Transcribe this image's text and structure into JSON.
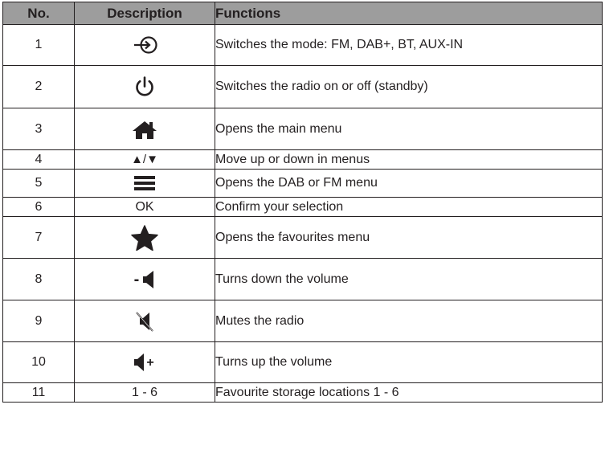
{
  "headers": {
    "no": "No.",
    "description": "Description",
    "functions": "Functions"
  },
  "rows": [
    {
      "no": "1",
      "icon": "mode-icon",
      "function": "Switches the mode: FM, DAB+, BT, AUX-IN"
    },
    {
      "no": "2",
      "icon": "power-icon",
      "function": "Switches the radio on or off (standby)"
    },
    {
      "no": "3",
      "icon": "home-icon",
      "function": "Opens the main menu"
    },
    {
      "no": "4",
      "description": "▲/▼",
      "function": "Move up or down in menus"
    },
    {
      "no": "5",
      "icon": "menu-icon",
      "function": "Opens the DAB or FM menu"
    },
    {
      "no": "6",
      "description": "OK",
      "function": "Confirm your selection"
    },
    {
      "no": "7",
      "icon": "star-icon",
      "function": "Opens the favourites menu"
    },
    {
      "no": "8",
      "icon": "volume-down-icon",
      "description": "-",
      "function": "Turns down the volume"
    },
    {
      "no": "9",
      "icon": "mute-icon",
      "function": "Mutes the radio"
    },
    {
      "no": "10",
      "icon": "volume-up-icon",
      "description": "+",
      "function": "Turns up the volume"
    },
    {
      "no": "11",
      "description": "1 - 6",
      "function": "Favourite storage locations 1 - 6"
    }
  ]
}
